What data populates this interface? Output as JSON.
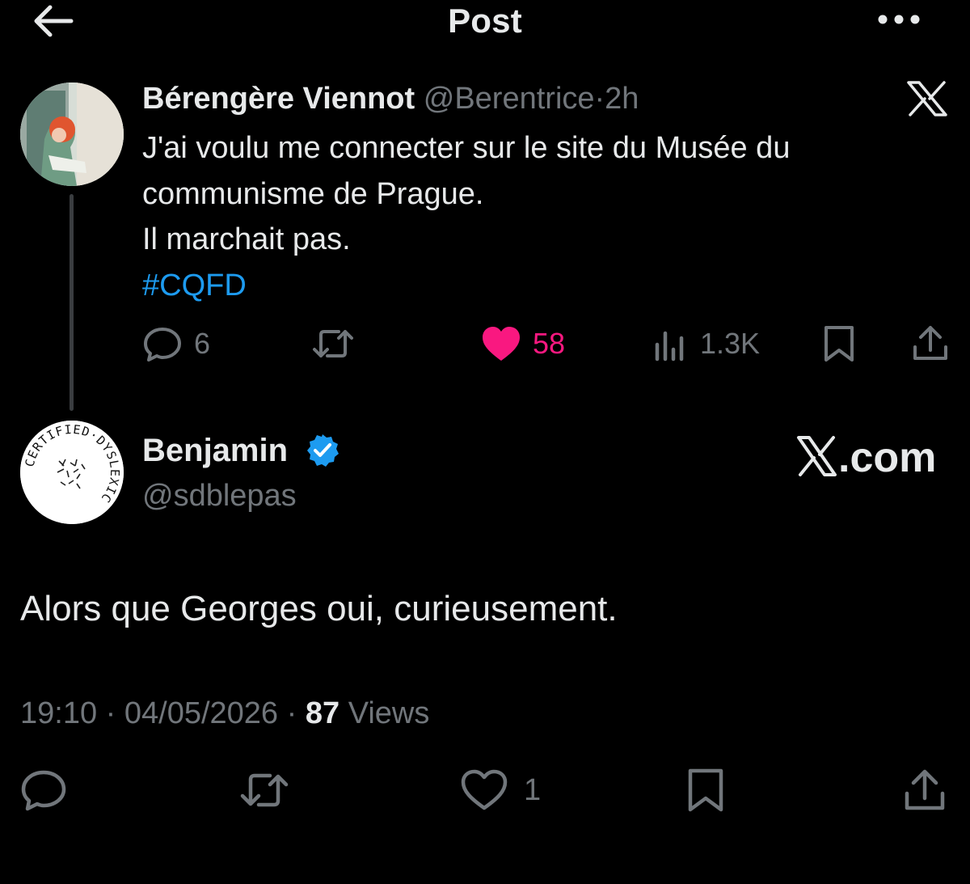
{
  "header": {
    "title": "Post"
  },
  "parent_post": {
    "author_name": "Bérengère Viennot",
    "handle": "@Berentrice",
    "separator": "·",
    "age": "2h",
    "text_lines": [
      "J'ai voulu me connecter sur le site du Musée du",
      "communisme de Prague.",
      "Il marchait pas."
    ],
    "hashtag": "#CQFD",
    "stats": {
      "replies": "6",
      "likes": "58",
      "views": "1.3K"
    }
  },
  "post": {
    "author_name": "Benjamin",
    "handle": "@sdblepas",
    "watermark": "X.com",
    "text": "Alors que Georges oui, curieusement.",
    "time": "19:10",
    "date": "04/05/2026",
    "separator": "·",
    "views_count": "87",
    "views_label": "Views",
    "likes": "1"
  },
  "avatar_badge_text": "CERTIFIED·DYSLEXIC",
  "colors": {
    "accent": "#1d9bf0",
    "like": "#f91880",
    "muted": "#71767b",
    "background": "#000000"
  },
  "icons": [
    "back-arrow-icon",
    "more-icon",
    "x-logo-icon",
    "reply-icon",
    "repost-icon",
    "heart-icon",
    "views-icon",
    "bookmark-icon",
    "share-icon",
    "verified-icon"
  ]
}
